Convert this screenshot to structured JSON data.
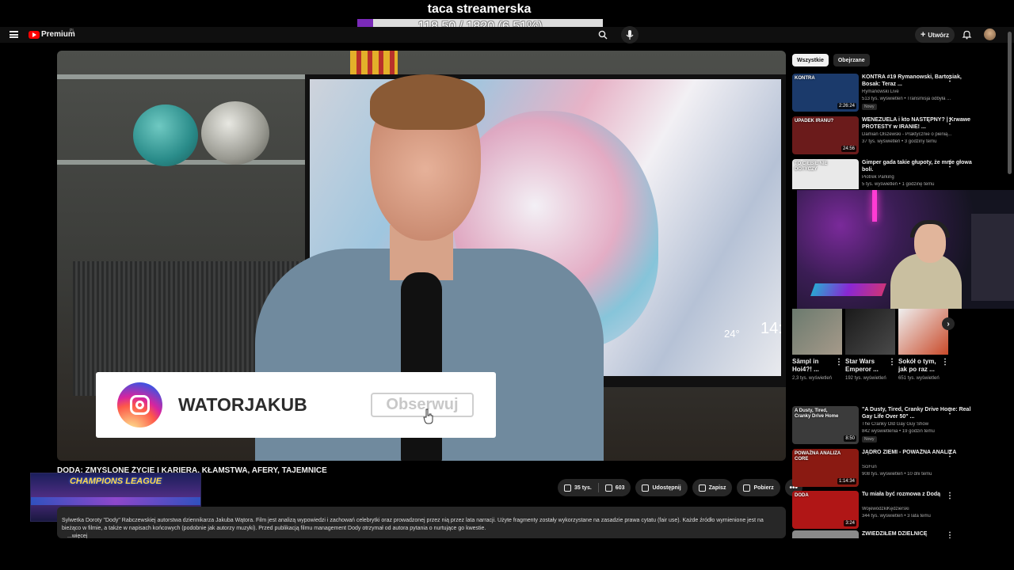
{
  "stream": {
    "title": "taca streamerska",
    "goal_text": "118.50 / 1820 (6.51%)",
    "goal_fraction": 0.0651
  },
  "header": {
    "brand": "Premium",
    "country_code": "PL",
    "create_label": "Utwórz"
  },
  "video": {
    "instagram_handle": "WATORJAKUB",
    "follow_label": "Obserwuj",
    "tv_temp": "24°",
    "tv_clock": "14:",
    "title": "DODA: ZMYŚLONE ŻYCIE I KARIERA, KŁAMSTWA, AFERY, TAJEMNICE",
    "overlay_banner": "CHAMPIONS LEAGUE",
    "likes": "35 tys.",
    "dislikes": "603",
    "share_label": "Udostępnij",
    "save_label": "Zapisz",
    "download_label": "Pobierz",
    "description": "Sylwetka Doroty \"Dody\" Rabczewskiej autorstwa dziennikarza Jakuba Wątora. Film jest analizą wypowiedzi i zachowań celebrytki oraz prowadzonej przez nią przez lata narracji. Użyte fragmenty zostały wykorzystane na zasadzie prawa cytatu (fair use). Każde źródło wymienione jest na bieżąco w filmie, a także w napisach końcowych (podobnie jak autorzy muzyki). Przed publikacją filmu management Dody otrzymał od autora pytania o nurtujące go kwestie.",
    "description_more": "...więcej"
  },
  "sidebar": {
    "chips": [
      "Wszystkie",
      "Obejrzane"
    ],
    "recs_top": [
      {
        "title": "KONTRA #19 Rymanowski, Bartosiak, Bosak: Teraz ...",
        "channel": "Rymanowski Live",
        "meta": "513 tys. wyświetleń • Transmisja odbyła ...",
        "badge": "Nowy",
        "duration": "2:26:24",
        "thumb_text": "KONTRA",
        "thumb_color": "#1b3a6b"
      },
      {
        "title": "WENEZUELA i kto NASTĘPNY? | Krwawe PROTESTY w IRANIE! ...",
        "channel": "Damian Olszewski - Praktycznie o pienią...",
        "meta": "37 tys. wyświetleń • 3 godziny temu",
        "badge": "",
        "duration": "24:56",
        "thumb_text": "UPADEK IRANU?",
        "thumb_color": "#6b1b1b"
      },
      {
        "title": "Gimper gada takie głupoty, że mnie głowa boli.",
        "channel": "Piotrek Parking",
        "meta": "5 tys. wyświetleń • 1 godzinę temu",
        "badge": "",
        "duration": "",
        "thumb_text": "TO CIEBIE NIE DOTYCZY",
        "thumb_color": "#e9e9e9"
      }
    ],
    "shorts": [
      {
        "title": "Sămpl in Hoi4?! ...",
        "meta": "2,3 tys. wyświetleń"
      },
      {
        "title": "Star Wars Emperor ...",
        "meta": "192 tys. wyświetleń"
      },
      {
        "title": "Sokół o tym, jak po raz ...",
        "meta": "651 tys. wyświetleń"
      }
    ],
    "recs_bottom": [
      {
        "title": "\"A Dusty, Tired, Cranky Drive Home: Real Gay Life Over 50\" ...",
        "channel": "The Cranky Old Gay Guy Show",
        "meta": "842 wyświetlenia • 19 godzin temu",
        "badge": "Nowy",
        "duration": "8:50",
        "thumb_text": "A Dusty, Tired, Cranky Drive Home",
        "thumb_color": "#3b3b3b"
      },
      {
        "title": "JĄDRO ZIEMI - POWAŻNA ANALIZA",
        "channel": "SciFun",
        "meta": "908 tys. wyświetleń • 10 dni temu",
        "badge": "",
        "duration": "1:14:34",
        "thumb_text": "POWAŻNA ANALIZA CORE",
        "thumb_color": "#8a1a12"
      },
      {
        "title": "Tu miała być rozmowa z Dodą",
        "channel": "WojewódzkiKędzierski",
        "meta": "344 tys. wyświetleń • 3 lata temu",
        "badge": "",
        "duration": "3:24",
        "thumb_text": "DODA",
        "thumb_color": "#b01616"
      },
      {
        "title": "ZWIEDZIŁEM DZIELNICĘ",
        "channel": "",
        "meta": "",
        "badge": "",
        "duration": "",
        "thumb_text": "",
        "thumb_color": "#8a8a8a"
      }
    ]
  }
}
